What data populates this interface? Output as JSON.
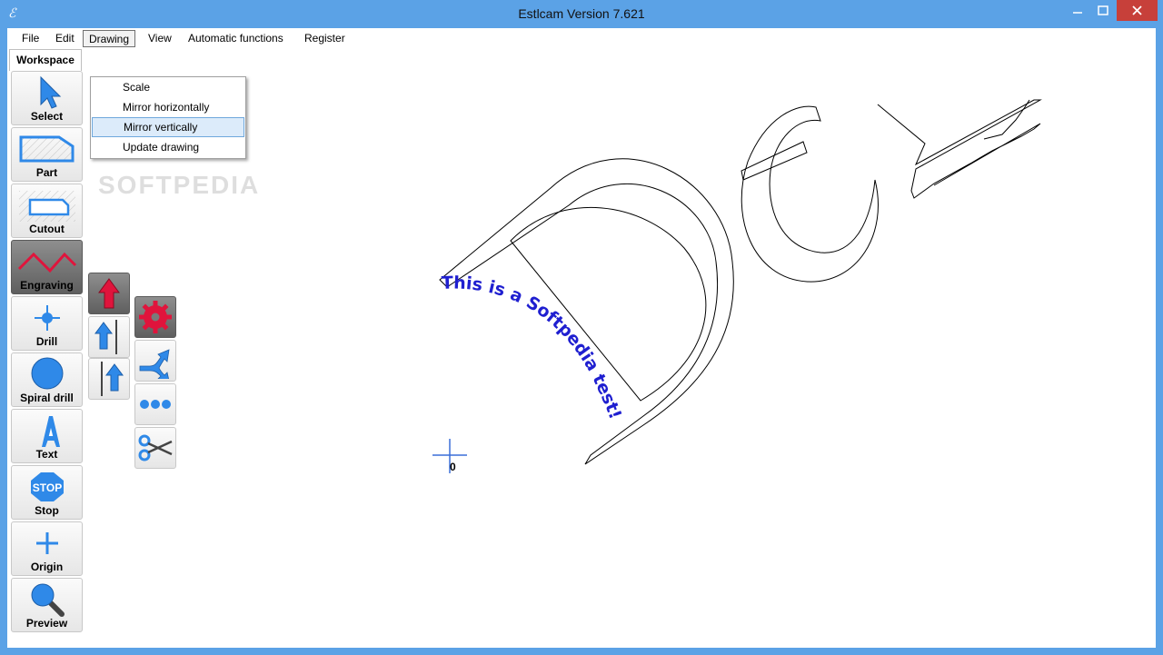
{
  "window": {
    "title": "Estlcam Version 7.621",
    "icon": "estlcam-icon"
  },
  "menu": [
    "File",
    "Edit",
    "Drawing",
    "View",
    "Automatic functions",
    "Register"
  ],
  "tab": {
    "label": "Workspace"
  },
  "dropdown": [
    "Scale",
    "Mirror horizontally",
    "Mirror vertically",
    "Update drawing"
  ],
  "tools": [
    "Select",
    "Part",
    "Cutout",
    "Engraving",
    "Drill",
    "Spiral drill",
    "Text",
    "Stop",
    "Origin",
    "Preview"
  ],
  "stop_icon_text": "STOP",
  "canvas": {
    "engraving_text": "This is a Softpedia test!",
    "origin_label": "0",
    "outline_letters": "Del"
  },
  "watermark": "SOFTPEDIA",
  "colors": {
    "titlebar": "#5ba2e6",
    "close_button": "#c7403a",
    "active_tool": "#6e6e6e",
    "icon_blue": "#2f89e8",
    "engraving_red": "#e0143c",
    "text_blue": "#1f1fd0",
    "menu_highlight": "#dcebfa"
  }
}
